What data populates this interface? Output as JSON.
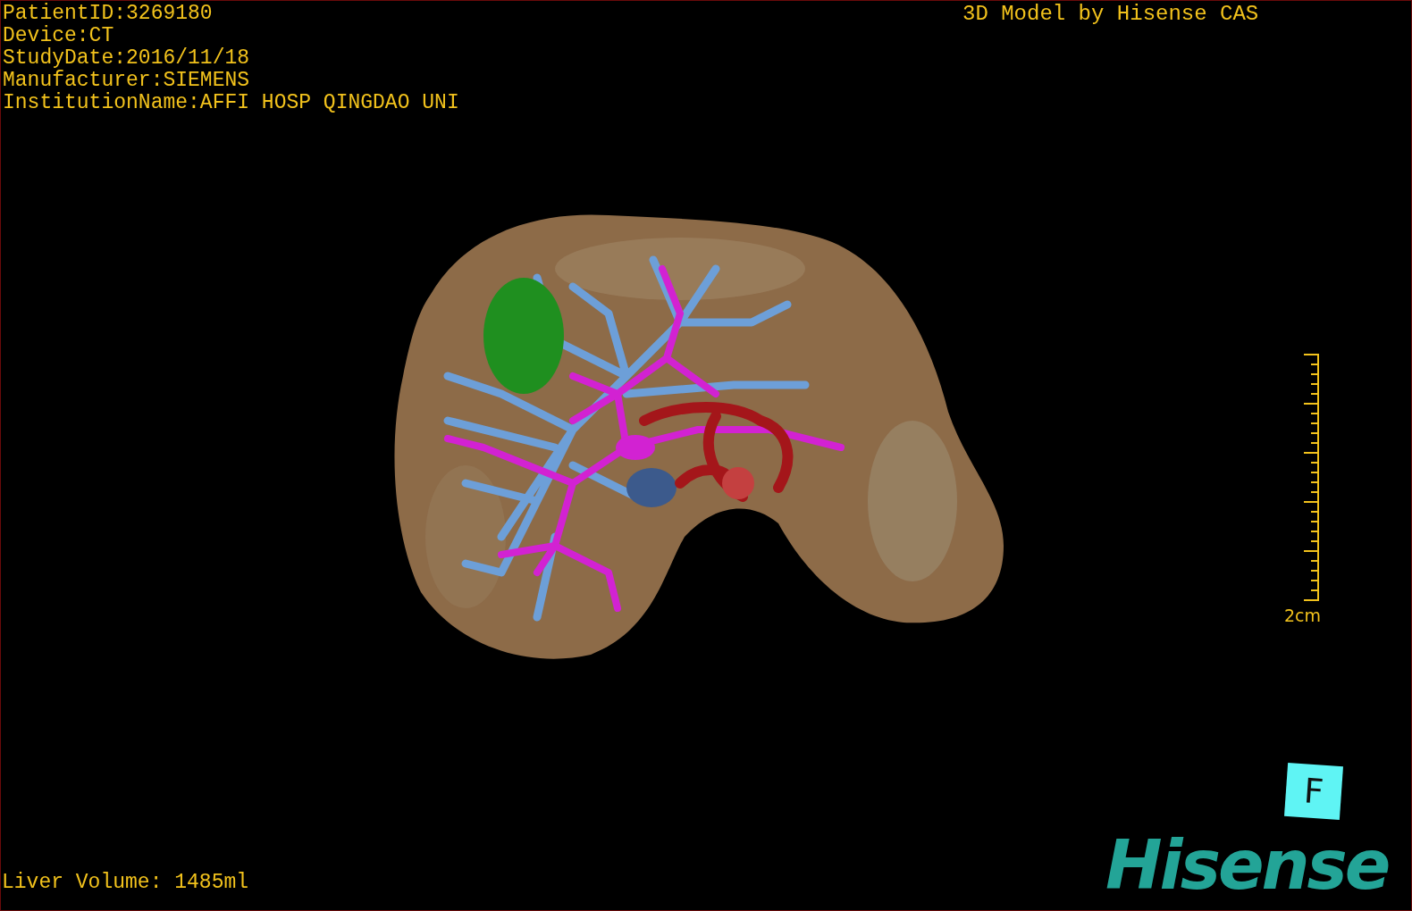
{
  "patient_info": [
    "PatientID:3269180",
    "Device:CT",
    "StudyDate:2016/11/18",
    "Manufacturer:SIEMENS",
    "InstitutionName:AFFI HOSP QINGDAO UNI"
  ],
  "title": "3D Model by Hisense CAS",
  "scale_bar": {
    "label": "2cm"
  },
  "orientation_cube": {
    "label": "F"
  },
  "liver_volume": "Liver Volume: 1485ml",
  "logo": "Hisense"
}
